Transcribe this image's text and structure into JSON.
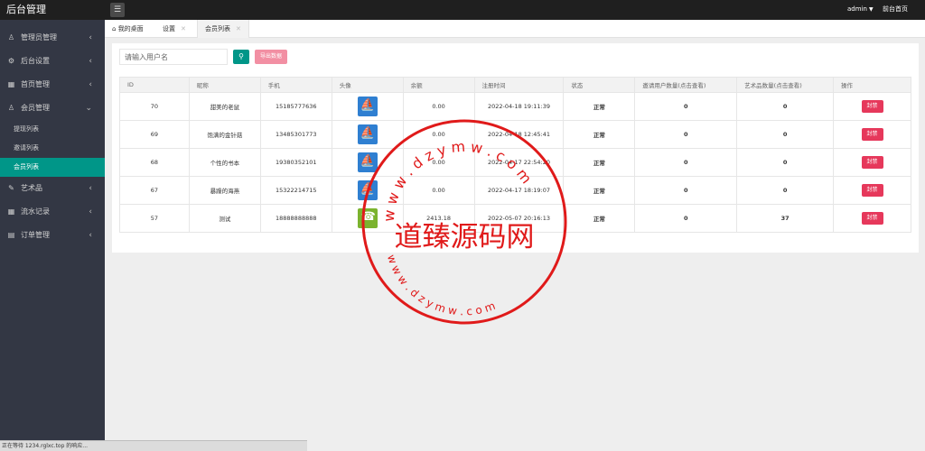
{
  "header": {
    "app_title": "后台管理",
    "menu_toggle_icon": "menu-icon",
    "user": "admin",
    "front_link": "前台首页"
  },
  "sidebar": {
    "items": [
      {
        "label": "管理员管理",
        "icon": "user-icon",
        "arrow": "‹"
      },
      {
        "label": "后台设置",
        "icon": "gear-icon",
        "arrow": "‹"
      },
      {
        "label": "首页管理",
        "icon": "grid-icon",
        "arrow": "‹"
      },
      {
        "label": "会员管理",
        "icon": "user-icon",
        "arrow": "⌄"
      },
      {
        "label": "艺术品",
        "icon": "pin-icon",
        "arrow": "‹"
      },
      {
        "label": "流水记录",
        "icon": "grid-icon",
        "arrow": "‹"
      },
      {
        "label": "订单管理",
        "icon": "doc-icon",
        "arrow": "‹"
      }
    ],
    "sub_items": [
      "提现列表",
      "邀请列表",
      "会员列表"
    ],
    "active_sub": "会员列表"
  },
  "tabs": [
    {
      "label": "我的桌面",
      "icon": "home-icon"
    },
    {
      "label": "设置",
      "close": "✕"
    },
    {
      "label": "会员列表",
      "close": "✕"
    }
  ],
  "search": {
    "placeholder": "请输入用户名",
    "button_icon": "search-icon"
  },
  "export_label": "导出数据",
  "table": {
    "headers": [
      "ID",
      "昵称",
      "手机",
      "头像",
      "余额",
      "注册时间",
      "状态",
      "邀请用户数量(点击查看)",
      "艺术品数量(点击查看)",
      "操作"
    ],
    "rows": [
      {
        "id": "70",
        "nickname": "甜美的老鼠",
        "phone": "15185777636",
        "avatar": "ship",
        "balance": "0.00",
        "registered": "2022-04-18 19:11:39",
        "status": "正常",
        "invites": "0",
        "artworks": "0",
        "action": "封禁"
      },
      {
        "id": "69",
        "nickname": "饱满的金针菇",
        "phone": "13485301773",
        "avatar": "ship",
        "balance": "0.00",
        "registered": "2022-04-18 12:45:41",
        "status": "正常",
        "invites": "0",
        "artworks": "0",
        "action": "封禁"
      },
      {
        "id": "68",
        "nickname": "个性的书本",
        "phone": "19380352101",
        "avatar": "ship",
        "balance": "0.00",
        "registered": "2022-04-17 22:54:20",
        "status": "正常",
        "invites": "0",
        "artworks": "0",
        "action": "封禁"
      },
      {
        "id": "67",
        "nickname": "暴躁的海燕",
        "phone": "15322214715",
        "avatar": "ship",
        "balance": "0.00",
        "registered": "2022-04-17 18:19:07",
        "status": "正常",
        "invites": "0",
        "artworks": "0",
        "action": "封禁"
      },
      {
        "id": "57",
        "nickname": "测试",
        "phone": "18888888888",
        "avatar": "wechat",
        "balance": "2413.18",
        "registered": "2022-05-07 20:16:13",
        "status": "正常",
        "invites": "0",
        "artworks": "37",
        "action": "封禁"
      }
    ]
  },
  "watermark": {
    "center_text": "道臻源码网",
    "ring_top": "w w w . d z y m w . c o m",
    "ring_bottom": "w w w . d z y m w . c o m",
    "color": "#e01a1a"
  },
  "status_bar": "正在等待 1234.rglxc.top 的响应..."
}
